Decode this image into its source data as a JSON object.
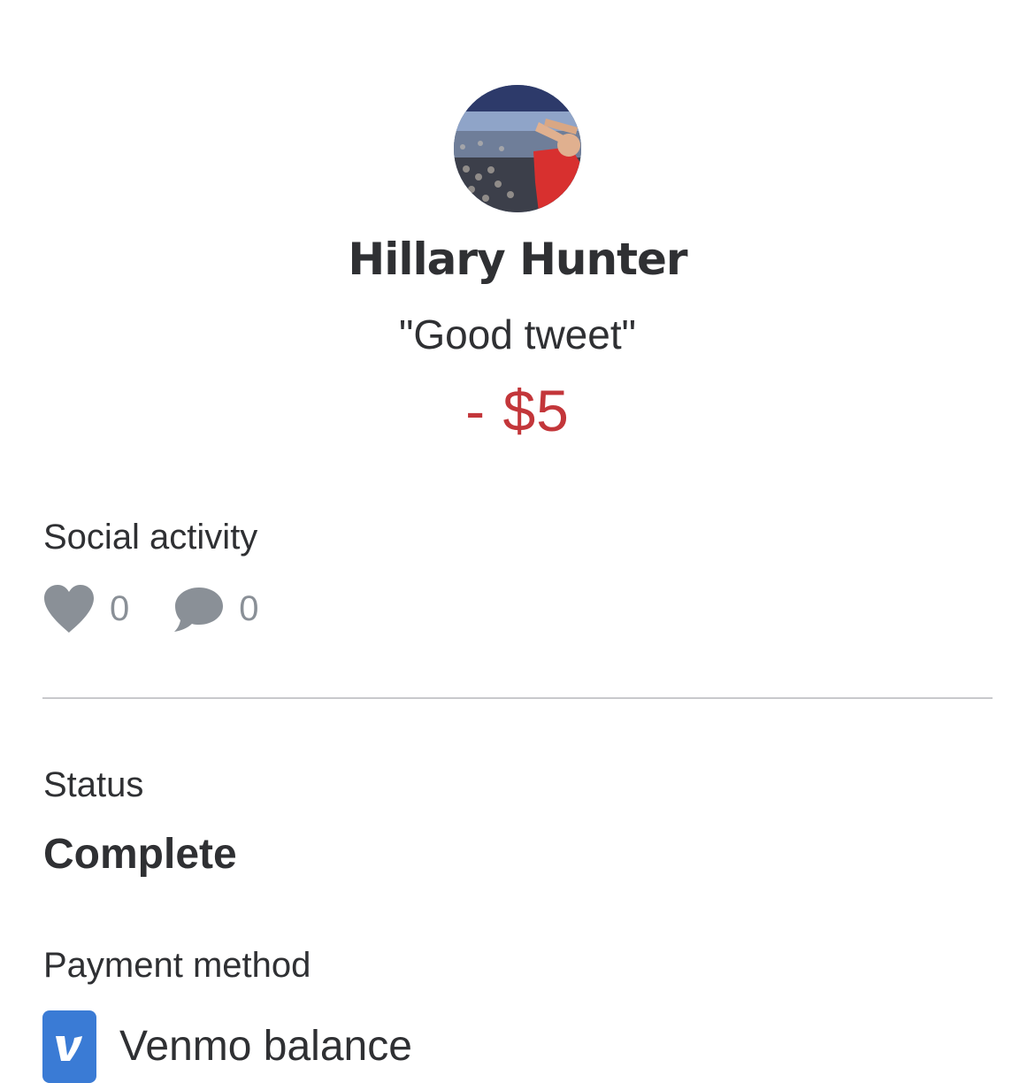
{
  "transaction": {
    "name": "Hillary Hunter",
    "note": "\"Good tweet\"",
    "amount": "- $5"
  },
  "social": {
    "label": "Social activity",
    "likes": "0",
    "comments": "0"
  },
  "status": {
    "label": "Status",
    "value": "Complete"
  },
  "payment": {
    "label": "Payment method",
    "value": "Venmo balance"
  },
  "icons": {
    "like": "heart-icon",
    "comment": "comment-bubble-icon",
    "payment": "venmo-logo-icon"
  },
  "colors": {
    "amount": "#c3363a",
    "icon_gray": "#8a9097",
    "venmo_blue": "#3a7bd5"
  }
}
